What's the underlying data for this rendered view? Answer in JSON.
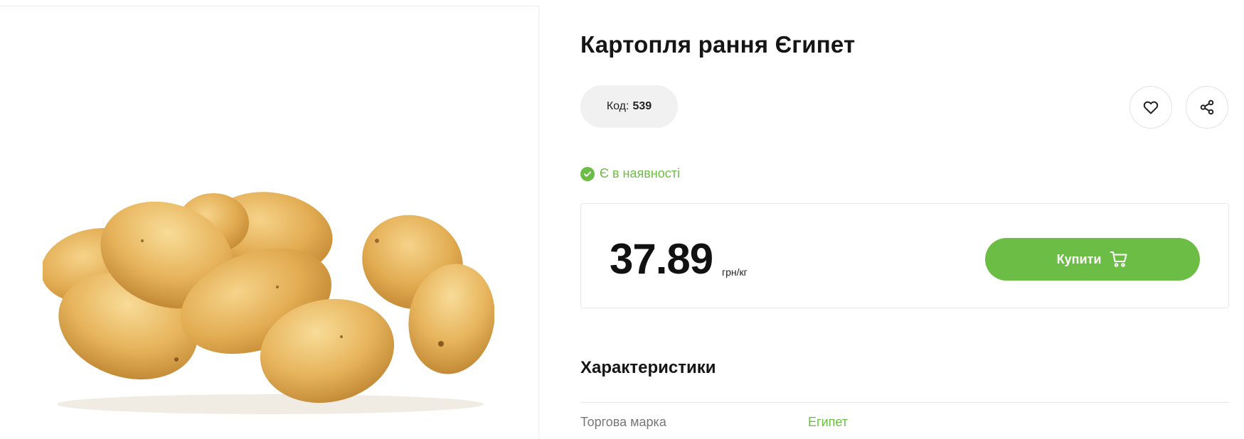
{
  "product": {
    "title": "Картопля рання Єгипет",
    "code_label": "Код:",
    "code_value": "539",
    "stock_status": "Є в наявності"
  },
  "price": {
    "value": "37.89",
    "unit": "грн/кг"
  },
  "actions": {
    "buy_label": "Купити",
    "favorite_icon": "heart-icon",
    "share_icon": "share-icon",
    "cart_icon": "cart-icon"
  },
  "specs": {
    "heading": "Характеристики",
    "rows": [
      {
        "label": "Торгова марка",
        "value": "Египет"
      }
    ]
  },
  "colors": {
    "accent": "#6cbd45",
    "badge_bg": "#f1f1f1",
    "border": "#e6e6e6"
  }
}
